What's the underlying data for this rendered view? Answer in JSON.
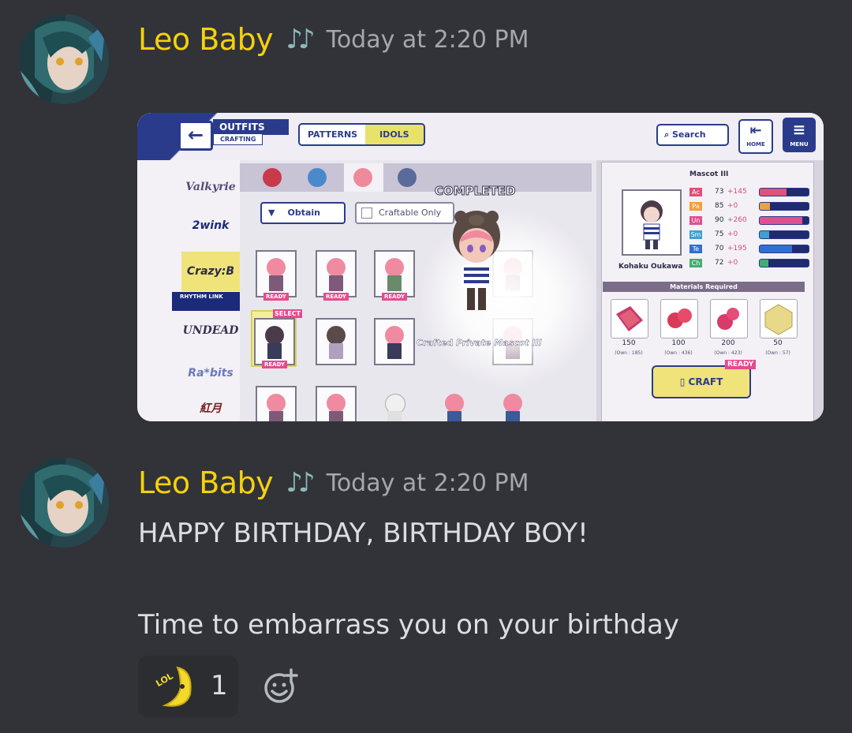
{
  "messages": [
    {
      "username": "Leo Baby",
      "role_icon": "music-notes-icon",
      "role_icon_glyph": "♪♪",
      "timestamp": "Today at 2:20 PM",
      "attachment": {
        "game": {
          "header": {
            "outfits": "OUTFITS",
            "crafting": "CRAFTING"
          },
          "tabs": [
            "PATTERNS",
            "IDOLS"
          ],
          "active_tab": "IDOLS",
          "search_label": "Search",
          "home_label": "HOME",
          "menu_label": "MENU",
          "units": [
            "Valkyrie",
            "2wink",
            "Crazy:B",
            "UNDEAD",
            "Ra*bits",
            "紅月"
          ],
          "selected_unit": "Crazy:B",
          "rhythm_link": "RHYTHM LINK",
          "obtain_label": "Obtain",
          "craftable_only_label": "Craftable Only",
          "ready_label": "READY",
          "select_label": "SELECT",
          "completed_label": "COMPLETED",
          "crafted_prefix": "Crafted",
          "crafted_item": "Private Mascot III",
          "item_name": "Mascot III",
          "character_name": "Kohaku Oukawa",
          "stats": [
            {
              "tag": "Ac",
              "value": "73",
              "bonus": "+145",
              "color": "#e0507a"
            },
            {
              "tag": "Pa",
              "value": "85",
              "bonus": "+0",
              "color": "#f0a040"
            },
            {
              "tag": "Un",
              "value": "90",
              "bonus": "+260",
              "color": "#e05090"
            },
            {
              "tag": "Sm",
              "value": "75",
              "bonus": "+0",
              "color": "#40a0d0"
            },
            {
              "tag": "Te",
              "value": "70",
              "bonus": "+195",
              "color": "#3070d0"
            },
            {
              "tag": "Ch",
              "value": "72",
              "bonus": "+0",
              "color": "#40b070"
            }
          ],
          "materials_required_label": "Materials Required",
          "materials": [
            {
              "count": "150",
              "own": "(Own : 185)"
            },
            {
              "count": "100",
              "own": "(Own : 436)"
            },
            {
              "count": "200",
              "own": "(Own : 423)"
            },
            {
              "count": "50",
              "own": "(Own : 57)"
            }
          ],
          "craft_label": "CRAFT",
          "craft_ready_label": "READY"
        }
      }
    },
    {
      "username": "Leo Baby",
      "role_icon": "music-notes-icon",
      "role_icon_glyph": "♪♪",
      "timestamp": "Today at 2:20 PM",
      "lines": [
        "HAPPY BIRTHDAY, BIRTHDAY BOY!",
        "Time to embarrass you on your birthday"
      ],
      "reaction": {
        "emoji": "banana-lol-emoji",
        "emoji_text": "LOL",
        "count": "1"
      },
      "add_reaction_icon": "add-reaction-icon"
    }
  ]
}
